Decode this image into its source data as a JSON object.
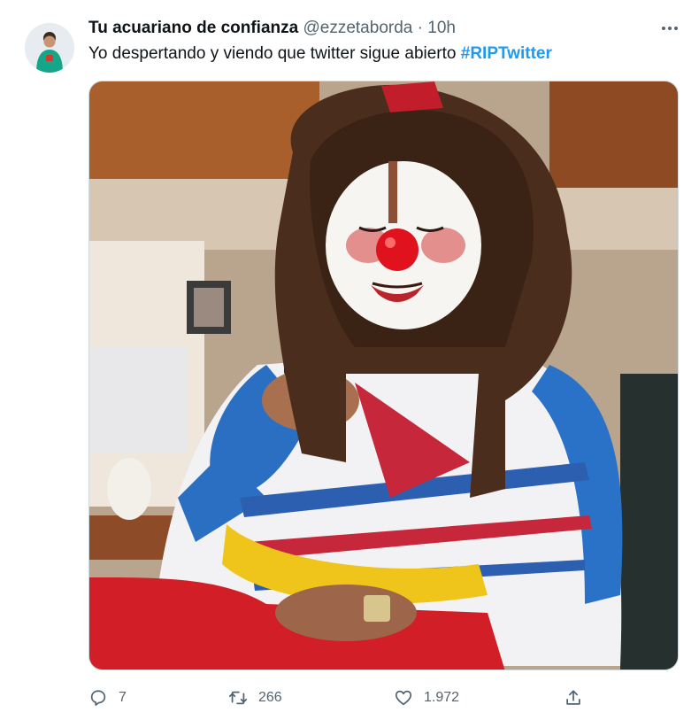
{
  "tweet": {
    "author_name": "Tu acuariano de confianza",
    "handle": "@ezzetaborda",
    "separator": "·",
    "time": "10h",
    "text": "Yo despertando y viendo que twitter sigue abierto",
    "hashtag": "#RIPTwitter"
  },
  "media": {
    "description_icon": "clown-photo"
  },
  "actions": {
    "reply_count": "7",
    "retweet_count": "266",
    "like_count": "1.972"
  },
  "colors": {
    "accent": "#1d9bf0",
    "secondary_text": "#536471"
  }
}
